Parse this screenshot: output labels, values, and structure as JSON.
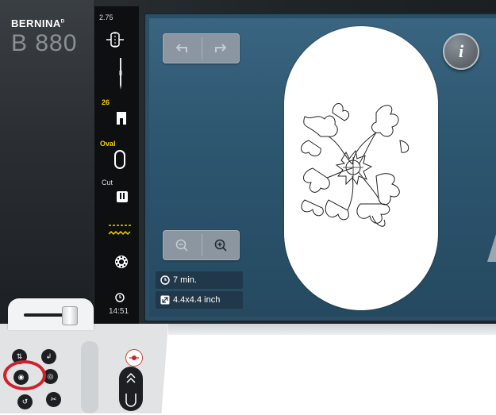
{
  "brand": {
    "logo": "BERNINA",
    "model": "B 880"
  },
  "status_bar": {
    "stitch_width": "2.75",
    "presser_foot_number": "26",
    "hoop_label": "Oval",
    "cut_label": "Cut",
    "clock_time": "14:51"
  },
  "screen": {
    "undo_icon": "undo-arrow",
    "redo_icon": "redo-arrow",
    "info_label": "i",
    "zoom_out_icon": "zoom-out",
    "zoom_in_icon": "zoom-in",
    "stitch_time": "7 min.",
    "design_size": "4.4x4.4 inch"
  },
  "colors": {
    "highlight": "#d0202a",
    "status_yellow": "#f2d000",
    "screen_blue": "#2d5670"
  }
}
